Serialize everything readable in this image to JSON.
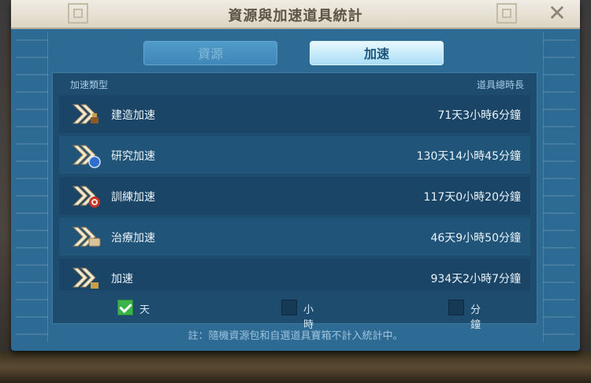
{
  "dialog": {
    "title": "資源與加速道具統計",
    "close_icon": "close-icon"
  },
  "tabs": [
    {
      "label": "資源",
      "active": false
    },
    {
      "label": "加速",
      "active": true
    }
  ],
  "table": {
    "col_type": "加速類型",
    "col_total": "道具總時長",
    "rows": [
      {
        "name": "建造加速",
        "value": "71天3小時6分鐘",
        "icon": "build-speedup-icon"
      },
      {
        "name": "研究加速",
        "value": "130天14小時45分鐘",
        "icon": "research-speedup-icon"
      },
      {
        "name": "訓練加速",
        "value": "117天0小時20分鐘",
        "icon": "training-speedup-icon"
      },
      {
        "name": "治療加速",
        "value": "46天9小時50分鐘",
        "icon": "healing-speedup-icon"
      },
      {
        "name": "加速",
        "value": "934天2小時7分鐘",
        "icon": "universal-speedup-icon"
      }
    ]
  },
  "units": [
    {
      "label": "天",
      "checked": true
    },
    {
      "label": "小時",
      "checked": false
    },
    {
      "label": "分鐘",
      "checked": false
    }
  ],
  "note": "註：隨機資源包和自選道具寶箱不計入統計中。",
  "colors": {
    "accent_green": "#3ab44a",
    "panel_blue": "#2d6a94"
  }
}
